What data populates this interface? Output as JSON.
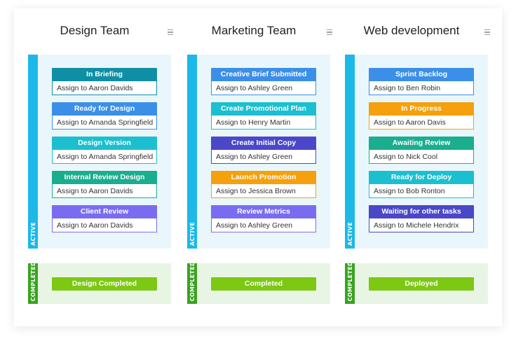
{
  "lanes": {
    "active": "ACTIVE",
    "completed": "COMPLETED"
  },
  "columns": [
    {
      "title": "Design Team",
      "cards": [
        {
          "status": "In Briefing",
          "assignee": "Assign to Aaron Davids",
          "color": "#0e8fa6"
        },
        {
          "status": "Ready for Design",
          "assignee": "Assign to Amanda Springfield",
          "color": "#3b8fe8"
        },
        {
          "status": "Design Version",
          "assignee": "Assign to Amanda Springfield",
          "color": "#1bbfcf"
        },
        {
          "status": "Internal Review Design",
          "assignee": "Assign to Aaron Davids",
          "color": "#1aae8e"
        },
        {
          "status": "Client Review",
          "assignee": "Assign to Aaron Davids",
          "color": "#7a6cf0"
        }
      ],
      "completed": "Design Completed"
    },
    {
      "title": "Marketing Team",
      "cards": [
        {
          "status": "Creative Brief Submitted",
          "assignee": "Assign to Ashley Green",
          "color": "#3b8fe8"
        },
        {
          "status": "Create Promotional Plan",
          "assignee": "Assign to Henry Martin",
          "color": "#1bbfcf"
        },
        {
          "status": "Create Initial Copy",
          "assignee": "Assign to Ashley Green",
          "color": "#4a47c9"
        },
        {
          "status": "Launch Promotion",
          "assignee": "Assign to Jessica Brown",
          "color": "#f5a00c"
        },
        {
          "status": "Review Metrics",
          "assignee": "Assign to Ashley Green",
          "color": "#7a6cf0"
        }
      ],
      "completed": "Completed"
    },
    {
      "title": "Web development",
      "cards": [
        {
          "status": "Sprint Backlog",
          "assignee": "Assign to Ben Robin",
          "color": "#3b8fe8"
        },
        {
          "status": "In Progress",
          "assignee": "Assign to Aaron Davis",
          "color": "#f5a00c"
        },
        {
          "status": "Awaiting Review",
          "assignee": "Assign to Nick Cool",
          "color": "#1aae8e"
        },
        {
          "status": "Ready for Deploy",
          "assignee": "Assign to Bob Ronton",
          "color": "#1bbfcf"
        },
        {
          "status": "Waiting for other tasks",
          "assignee": "Assign to Michele Hendrix",
          "color": "#4a47c9"
        }
      ],
      "completed": "Deployed"
    }
  ]
}
